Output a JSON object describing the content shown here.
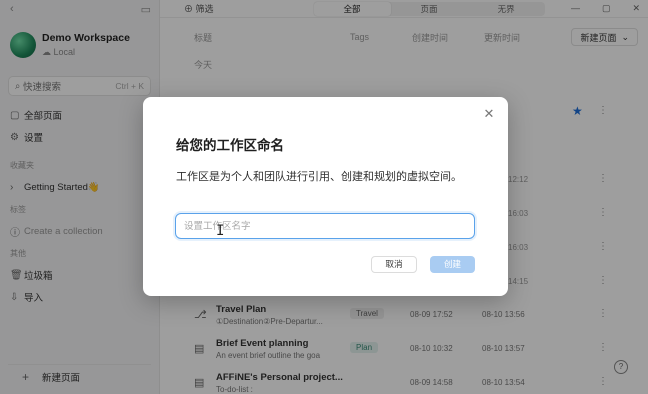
{
  "sidebar": {
    "workspace_name": "Demo Workspace",
    "workspace_sub": "Local",
    "search_label": "快速搜索",
    "search_shortcut": "Ctrl + K",
    "items": [
      {
        "label": "全部页面"
      },
      {
        "label": "设置"
      }
    ],
    "favorites_label": "收藏夹",
    "favorite_item": "Getting Started👋",
    "tags_label": "标签",
    "create_collection": "Create a collection",
    "others_label": "其他",
    "trash": "垃圾箱",
    "import": "导入",
    "new_page": "新建页面"
  },
  "topbar": {
    "filter": "筛选",
    "tabs": [
      "全部",
      "页面",
      "无界"
    ]
  },
  "table": {
    "columns": {
      "title": "标题",
      "tags": "Tags",
      "created": "创建时间",
      "updated": "更新时间"
    },
    "new_page_button": "新建页面",
    "group_today": "今天",
    "partial_dates": [
      "12:12",
      "16:03",
      "16:03",
      "14:15"
    ],
    "rows": [
      {
        "title": "Travel Plan",
        "subtitle": "①Destination②Pre-Departur...",
        "tag": "Travel",
        "created": "08-09 17:52",
        "updated": "08-10 13:56"
      },
      {
        "title": "Brief Event planning",
        "subtitle": "An event brief outline the goa",
        "tag": "Plan",
        "created": "08-10 10:32",
        "updated": "08-10 13:57"
      },
      {
        "title": "AFFiNE's Personal project...",
        "subtitle": "To-do-list :",
        "tag": "",
        "created": "08-09 14:58",
        "updated": "08-10 13:54"
      }
    ]
  },
  "dialog": {
    "title": "给您的工作区命名",
    "description": "工作区是为个人和团队进行引用、创建和规划的虚拟空间。",
    "input_placeholder": "设置工作区名字",
    "input_value": "",
    "cancel_label": "取消",
    "create_label": "创建"
  },
  "colors": {
    "accent": "#1e6fd9",
    "create_disabled": "#a9ccf2",
    "input_focus": "#5aa2ea"
  }
}
